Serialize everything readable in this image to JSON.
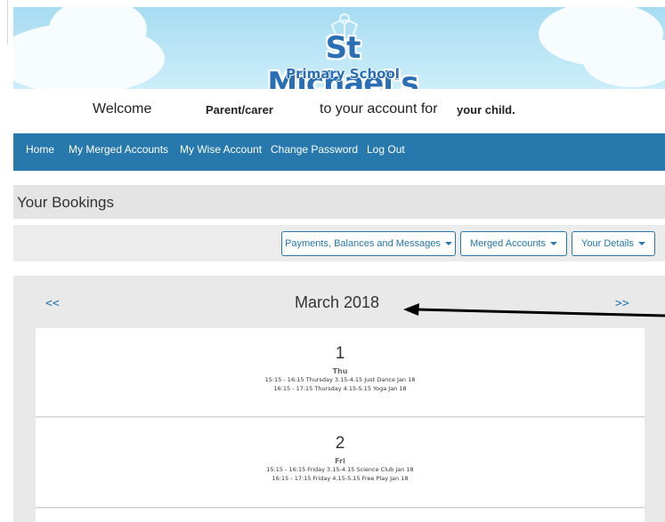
{
  "banner": {
    "school_name_line1": "St Michael's",
    "school_name_line2": "Primary School"
  },
  "welcome": {
    "prefix": "Welcome",
    "role": "Parent/carer",
    "middle": "to your account for",
    "child": "your child."
  },
  "nav": {
    "items": [
      {
        "label": "Home"
      },
      {
        "label": "My Merged Accounts"
      },
      {
        "label": "My Wise Account"
      },
      {
        "label": "Change Password"
      },
      {
        "label": "Log Out"
      }
    ]
  },
  "page": {
    "title": "Your Bookings"
  },
  "toolbar": {
    "buttons": [
      {
        "label": "Payments, Balances and Messages"
      },
      {
        "label": "Merged Accounts"
      },
      {
        "label": "Your Details"
      }
    ]
  },
  "calendar": {
    "prev": "<<",
    "next": ">>",
    "month": "March 2018",
    "days": [
      {
        "number": "1",
        "weekday": "Thu",
        "sessions": [
          "15:15 - 16:15 Thursday 3.15-4.15 Just Dance Jan 18",
          "16:15 - 17:15 Thursday 4.15-5.15 Yoga Jan 18"
        ]
      },
      {
        "number": "2",
        "weekday": "Fri",
        "sessions": [
          "15:15 - 16:15 Friday 3.15-4.15 Science Club Jan 18",
          "16:15 - 17:15 Friday 4.15-5.15 Free Play Jan 18"
        ]
      }
    ]
  },
  "colors": {
    "nav_bg": "#2678ad",
    "banner_sky": "#a6dcf1",
    "logo_blue": "#2a6fb6",
    "panel_grey": "#e9e9e9"
  }
}
